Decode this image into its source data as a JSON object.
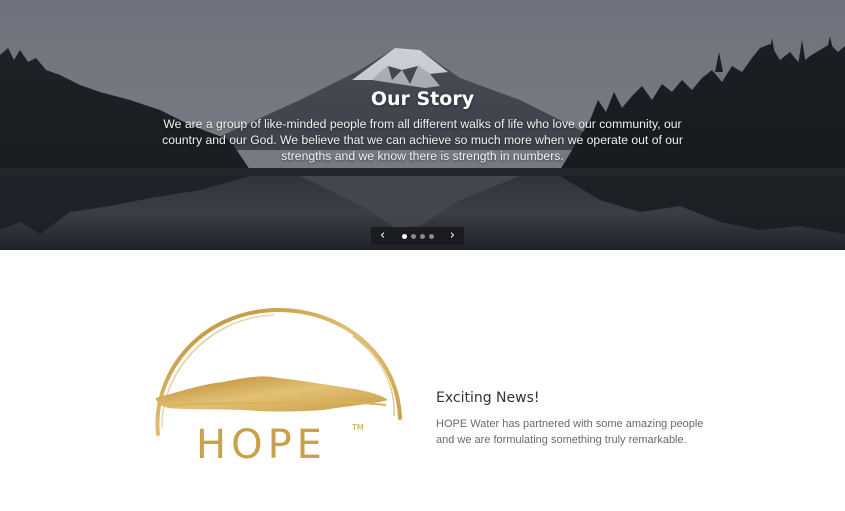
{
  "hero": {
    "title": "Our Story",
    "text": "We are a group of like-minded people from all different walks of life who love our community, our country and our God. We believe that we can achieve so much more when we operate out of our strengths and we know there is strength in numbers.",
    "slider": {
      "prev_icon": "chevron-left-icon",
      "next_icon": "chevron-right-icon",
      "prev_glyph": "‹",
      "next_glyph": "›",
      "slide_count": 4,
      "active_slide": 1
    }
  },
  "logo": {
    "text": "HOPE",
    "trademark": "TM",
    "color": "#c9a14a"
  },
  "news": {
    "title": "Exciting News!",
    "text": "HOPE Water has partnered with some amazing people and we are formulating something truly remarkable."
  }
}
